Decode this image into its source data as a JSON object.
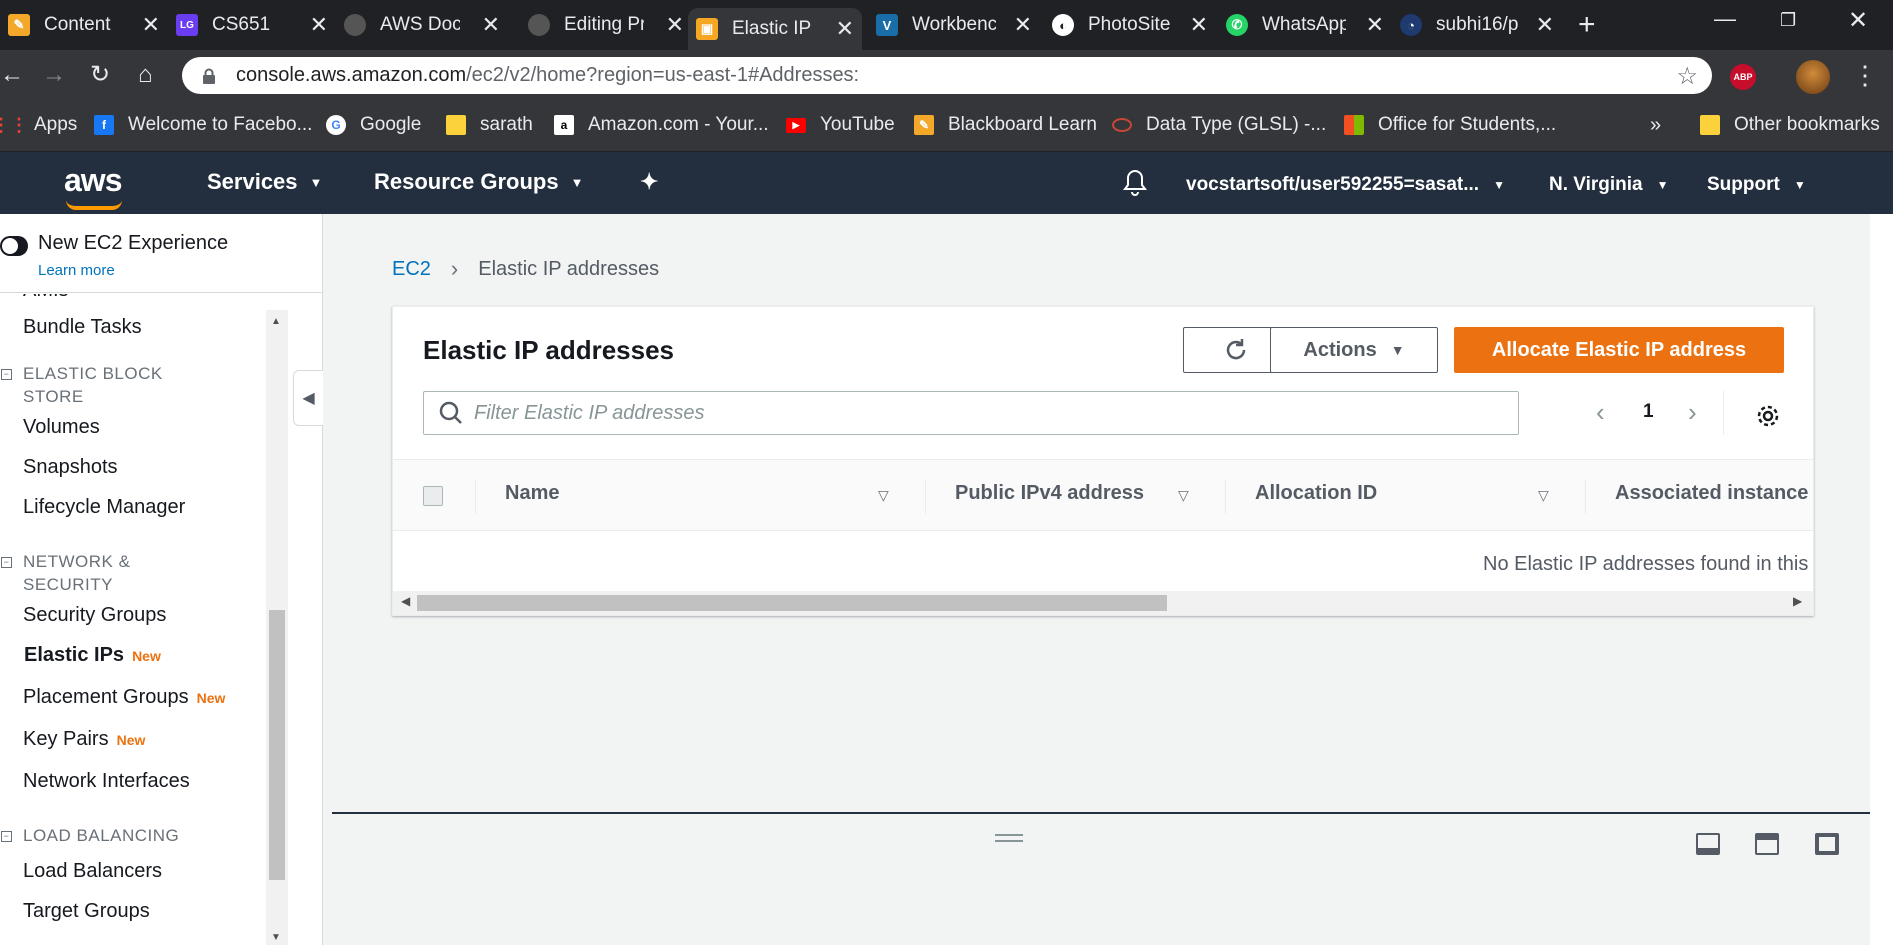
{
  "browser": {
    "tabs": [
      {
        "title": "Content",
        "color": "#f4a82a",
        "glyph": "✎"
      },
      {
        "title": "CS651",
        "color": "#6a3df0",
        "glyph": "LG"
      },
      {
        "title": "AWS Dock",
        "color": "#24292e",
        "glyph": "●"
      },
      {
        "title": "Editing Pr",
        "color": "#24292e",
        "glyph": "●"
      },
      {
        "title": "Elastic IP a",
        "color": "#f5a623",
        "glyph": "▣"
      },
      {
        "title": "Workbenc",
        "color": "#1a6ea8",
        "glyph": "V"
      },
      {
        "title": "PhotoSite",
        "color": "#ffffff",
        "glyph": "◐"
      },
      {
        "title": "WhatsApp",
        "color": "#25d366",
        "glyph": "✆"
      },
      {
        "title": "subhi16/p",
        "color": "#1e3a6e",
        "glyph": "◔"
      }
    ],
    "url_main": "console.aws.amazon.com",
    "url_path": "/ec2/v2/home?region=us-east-1#Addresses:",
    "extension_label": "ABP",
    "bookmarks": [
      {
        "label": "Apps",
        "color": "#ea4335"
      },
      {
        "label": "Welcome to Facebo...",
        "color": "#1877f2"
      },
      {
        "label": "Google",
        "color": "#ffffff"
      },
      {
        "label": "sarath",
        "color": "#fbd23b"
      },
      {
        "label": "Amazon.com - Your...",
        "color": "#ffffff"
      },
      {
        "label": "YouTube",
        "color": "#ff0000"
      },
      {
        "label": "Blackboard Learn",
        "color": "#f4a82a"
      },
      {
        "label": "Data Type (GLSL) -...",
        "color": "#c74634"
      },
      {
        "label": "Office for Students,...",
        "color": "#f25022"
      }
    ],
    "overflow": "»",
    "other_bookmarks": "Other bookmarks"
  },
  "aws": {
    "logo": "aws",
    "services": "Services",
    "resource_groups": "Resource Groups",
    "account": "vocstartsoft/user592255=sasat...",
    "region": "N. Virginia",
    "support": "Support"
  },
  "sidebar": {
    "new_experience": "New EC2 Experience",
    "learn_more": "Learn more",
    "partial_item": "AMIs",
    "bundle_tasks": "Bundle Tasks",
    "ebs_header": "ELASTIC BLOCK STORE",
    "volumes": "Volumes",
    "snapshots": "Snapshots",
    "lifecycle": "Lifecycle Manager",
    "network_header": "NETWORK & SECURITY",
    "security_groups": "Security Groups",
    "elastic_ips": "Elastic IPs",
    "placement_groups": "Placement Groups",
    "key_pairs": "Key Pairs",
    "network_interfaces": "Network Interfaces",
    "lb_header": "LOAD BALANCING",
    "load_balancers": "Load Balancers",
    "target_groups": "Target Groups",
    "new_badge": "New"
  },
  "main": {
    "breadcrumb_root": "EC2",
    "breadcrumb_current": "Elastic IP addresses",
    "panel_title": "Elastic IP addresses",
    "actions": "Actions",
    "allocate": "Allocate Elastic IP address",
    "filter_placeholder": "Filter Elastic IP addresses",
    "page": "1",
    "columns": [
      "Name",
      "Public IPv4 address",
      "Allocation ID",
      "Associated instance"
    ],
    "empty_message": "No Elastic IP addresses found in this region"
  }
}
